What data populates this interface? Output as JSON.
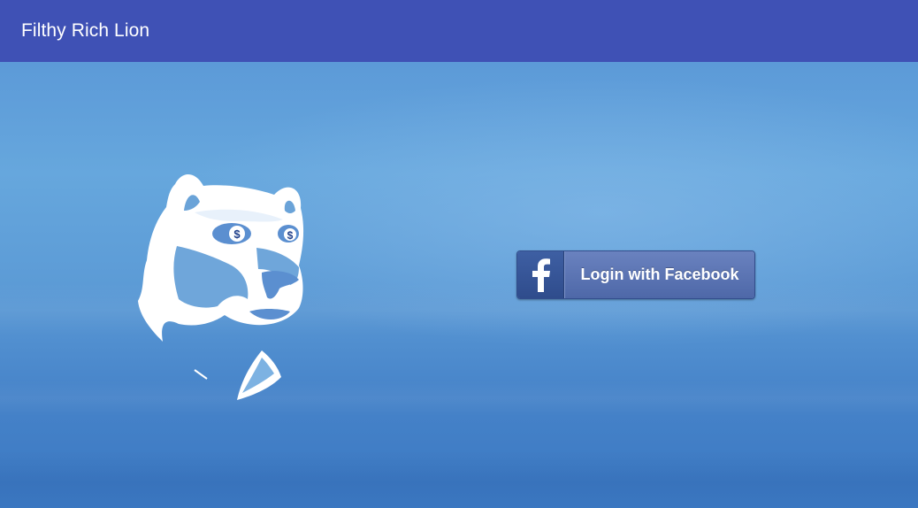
{
  "app": {
    "title": "Filthy Rich Lion"
  },
  "logo": {
    "icon": "lion-head-dollar-eyes-icon",
    "eye_symbol": "$"
  },
  "login": {
    "button_label": "Login with Facebook",
    "provider_icon": "facebook-icon",
    "provider_glyph": "f"
  },
  "colors": {
    "appbar": "#3f51b5",
    "background": "#5c9bd6",
    "facebook_dark": "#3b5998",
    "facebook_light": "#5f77b6"
  }
}
